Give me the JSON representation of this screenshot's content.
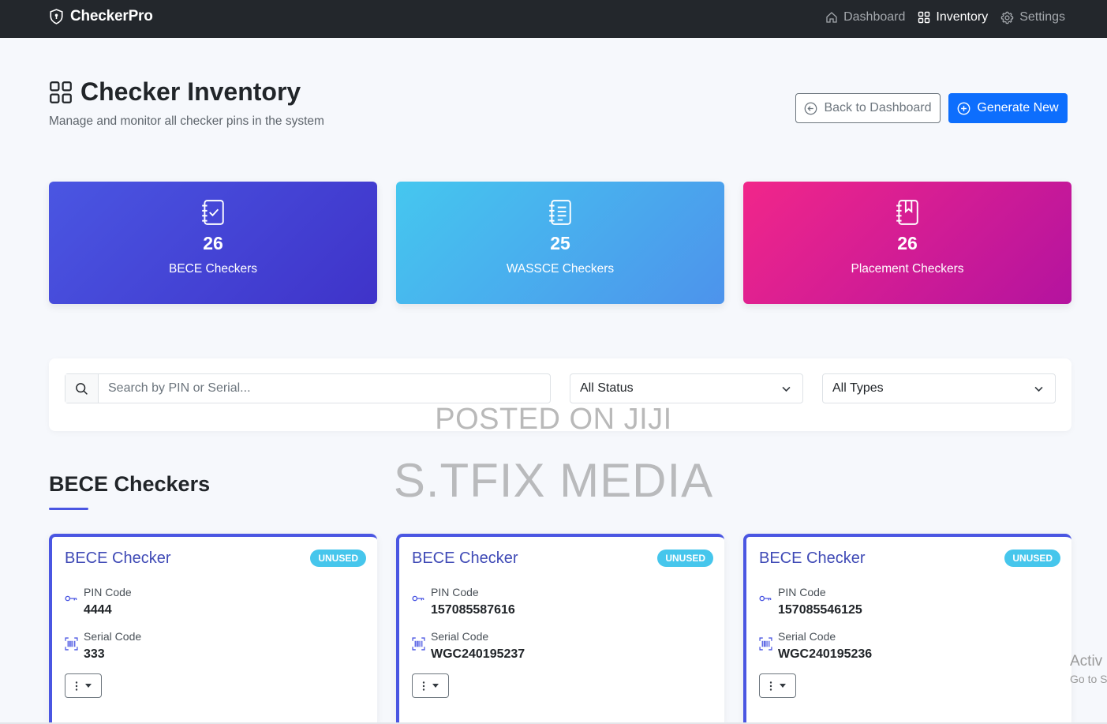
{
  "navbar": {
    "brand": "CheckerPro",
    "links": [
      {
        "label": "Dashboard",
        "icon": "house-icon",
        "active": false
      },
      {
        "label": "Inventory",
        "icon": "grid-icon",
        "active": true
      },
      {
        "label": "Settings",
        "icon": "gear-icon",
        "active": false
      }
    ]
  },
  "header": {
    "title": "Checker Inventory",
    "subtitle": "Manage and monitor all checker pins in the system",
    "back_label": "Back to Dashboard",
    "generate_label": "Generate New"
  },
  "stats": [
    {
      "count": "26",
      "label": "BECE Checkers",
      "icon": "journal-check-icon"
    },
    {
      "count": "25",
      "label": "WASSCE Checkers",
      "icon": "journal-text-icon"
    },
    {
      "count": "26",
      "label": "Placement Checkers",
      "icon": "journal-bookmark-icon"
    }
  ],
  "filters": {
    "search_placeholder": "Search by PIN or Serial...",
    "status_selected": "All Status",
    "type_selected": "All Types"
  },
  "watermark": {
    "line1": "POSTED ON JIJI",
    "line2": "S.TFIX MEDIA"
  },
  "section": {
    "title": "BECE Checkers"
  },
  "checkers": [
    {
      "title": "BECE Checker",
      "status": "UNUSED",
      "pin_label": "PIN Code",
      "pin": "4444",
      "serial_label": "Serial Code",
      "serial": "333"
    },
    {
      "title": "BECE Checker",
      "status": "UNUSED",
      "pin_label": "PIN Code",
      "pin": "157085587616",
      "serial_label": "Serial Code",
      "serial": "WGC240195237"
    },
    {
      "title": "BECE Checker",
      "status": "UNUSED",
      "pin_label": "PIN Code",
      "pin": "157085546125",
      "serial_label": "Serial Code",
      "serial": "WGC240195236"
    }
  ],
  "os_overlay": {
    "line1": "Activ",
    "line2": "Go to S"
  },
  "colors": {
    "navbar": "#23272c",
    "primary": "#0d6efd",
    "accent": "#4a56e2",
    "badge": "#46c6ec"
  }
}
